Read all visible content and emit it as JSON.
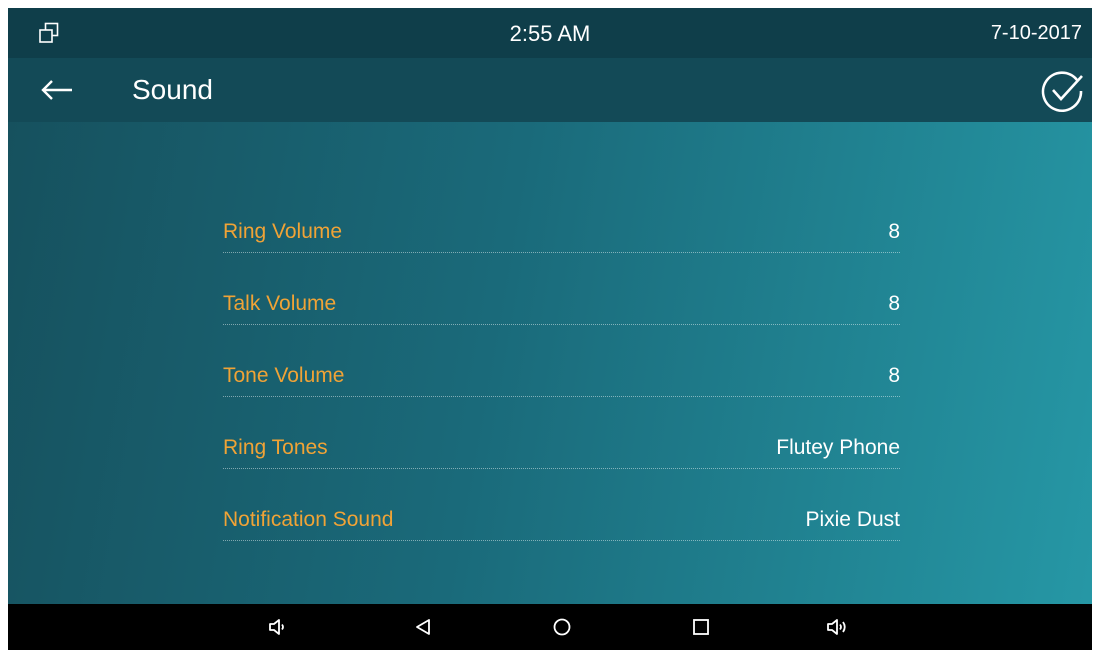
{
  "status_bar": {
    "time": "2:55 AM",
    "date": "7-10-2017",
    "left_icon": "windows-icon"
  },
  "header": {
    "title": "Sound",
    "back_icon": "arrow-left-icon",
    "confirm_icon": "check-circle-icon"
  },
  "settings": [
    {
      "label": "Ring Volume",
      "value": "8"
    },
    {
      "label": "Talk Volume",
      "value": "8"
    },
    {
      "label": "Tone Volume",
      "value": "8"
    },
    {
      "label": "Ring Tones",
      "value": "Flutey Phone"
    },
    {
      "label": "Notification Sound",
      "value": "Pixie Dust"
    }
  ],
  "nav_bar": {
    "buttons": [
      "volume-down-icon",
      "back-triangle-icon",
      "home-circle-icon",
      "recents-square-icon",
      "volume-up-icon"
    ]
  },
  "colors": {
    "label": "#f0a336",
    "value": "#ffffff",
    "status_bar_bg": "#0f3e4a",
    "title_bar_bg": "#134a57",
    "nav_bar_bg": "#000000"
  }
}
